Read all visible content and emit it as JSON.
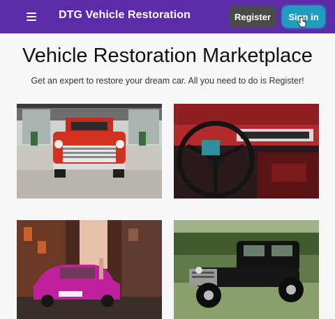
{
  "appbar": {
    "brand": "DTG Vehicle Restoration",
    "register_label": "Register",
    "signin_label": "Sign in"
  },
  "main": {
    "title": "Vehicle Restoration Marketplace",
    "subtitle": "Get an expert to restore your dream car. All you need to do is Register!"
  },
  "colors": {
    "appbar": "#5c2ba9",
    "register_button": "#4a4a4a",
    "signin_button": "#1e9dbf"
  },
  "gallery": {
    "photos": [
      "red-pickup-truck-photo",
      "red-dashboard-interior-photo",
      "pink-classic-car-street-photo",
      "black-hot-rod-photo"
    ]
  }
}
